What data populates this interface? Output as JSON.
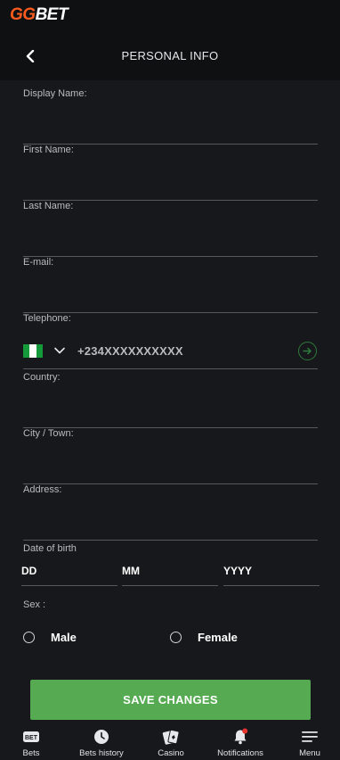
{
  "brand": {
    "logo_gg": "GG",
    "logo_bet": "BET"
  },
  "header": {
    "title": "PERSONAL INFO"
  },
  "form": {
    "display_name": {
      "label": "Display Name:",
      "value": ""
    },
    "first_name": {
      "label": "First Name:",
      "value": ""
    },
    "last_name": {
      "label": "Last Name:",
      "value": ""
    },
    "email": {
      "label": "E-mail:",
      "value": ""
    },
    "telephone": {
      "label": "Telephone:",
      "value": "+234XXXXXXXXXX",
      "country_flag": "nigeria-flag-icon"
    },
    "country": {
      "label": "Country:",
      "value": ""
    },
    "city": {
      "label": "City / Town:",
      "value": ""
    },
    "address": {
      "label": "Address:",
      "value": ""
    },
    "dob": {
      "label": "Date of birth",
      "day": "DD",
      "month": "MM",
      "year": "YYYY"
    },
    "sex": {
      "label": "Sex :",
      "options": [
        "Male",
        "Female"
      ]
    },
    "save_label": "SAVE CHANGES"
  },
  "nav": {
    "items": [
      {
        "label": "Bets",
        "icon": "bet-ticket-icon"
      },
      {
        "label": "Bets history",
        "icon": "clock-icon"
      },
      {
        "label": "Casino",
        "icon": "cards-icon"
      },
      {
        "label": "Notifications",
        "icon": "bell-icon"
      },
      {
        "label": "Menu",
        "icon": "hamburger-menu-icon"
      }
    ]
  },
  "colors": {
    "background": "#17181b",
    "header": "#0f1012",
    "accent_orange": "#ff5b1e",
    "save_green": "#56ab52",
    "notification_dot": "#e3342f"
  }
}
